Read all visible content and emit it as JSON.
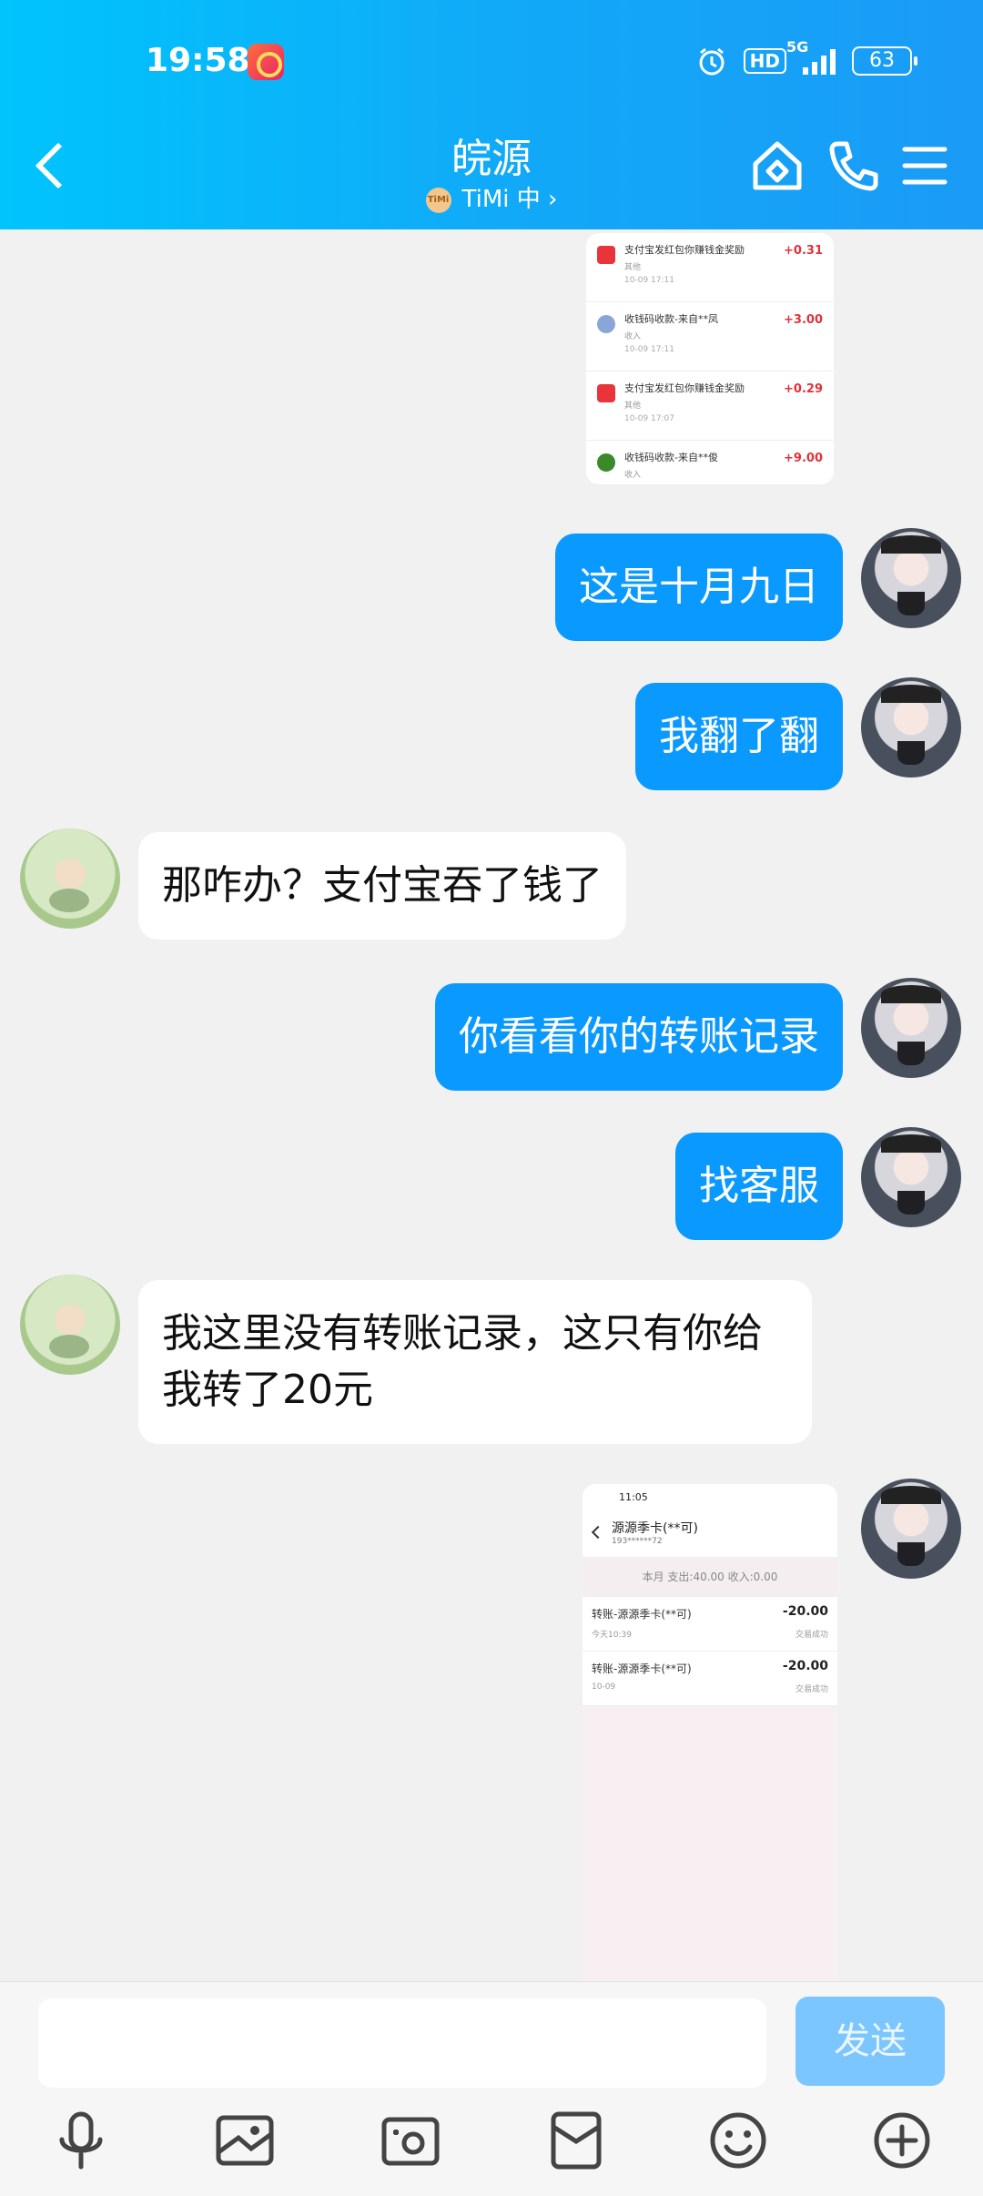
{
  "status": {
    "time": "19:58",
    "hd": "HD",
    "network": "5G",
    "battery": "63"
  },
  "header": {
    "title": "皖源",
    "subtitle": "TiMi 中 ›",
    "badge": "TiMi"
  },
  "messages": {
    "m1": "这是十月九日",
    "m2": "我翻了翻",
    "m3": "那咋办？支付宝吞了钱了",
    "m4": "你看看你的转账记录",
    "m5": "找客服",
    "m6": "我这里没有转账记录，这只有你给我转了20元"
  },
  "record_image": {
    "rows": [
      {
        "title": "支付宝发红包你赚钱金奖励",
        "sub": "其他",
        "time": "10-09 17:11",
        "amount": "+0.31",
        "icon_color": "#e8343a"
      },
      {
        "title": "收钱码收款-来自**凤",
        "sub": "收入",
        "time": "10-09 17:11",
        "amount": "+3.00",
        "icon_color": "#8aa6d8"
      },
      {
        "title": "支付宝发红包你赚钱金奖励",
        "sub": "其他",
        "time": "10-09 17:07",
        "amount": "+0.29",
        "icon_color": "#e8343a"
      },
      {
        "title": "收钱码收款-来自**俊",
        "sub": "收入",
        "time": "",
        "amount": "+9.00",
        "icon_color": "#3a8a2a"
      }
    ]
  },
  "transfer_image": {
    "time": "11:05",
    "name": "源源季卡(**可)",
    "phone": "193******72",
    "summary": "本月  支出:40.00  收入:0.00",
    "rows": [
      {
        "title": "转账-源源季卡(**可)",
        "date": "今天10:39",
        "amount": "-20.00",
        "status": "交易成功"
      },
      {
        "title": "转账-源源季卡(**可)",
        "date": "10-09",
        "amount": "-20.00",
        "status": "交易成功"
      }
    ]
  },
  "input": {
    "placeholder": "",
    "send_label": "发送"
  },
  "colors": {
    "header_start": "#00c4fc",
    "header_end": "#1a9bf6",
    "my_bubble": "#0a99ff",
    "send_disabled": "#7cc6ff"
  }
}
